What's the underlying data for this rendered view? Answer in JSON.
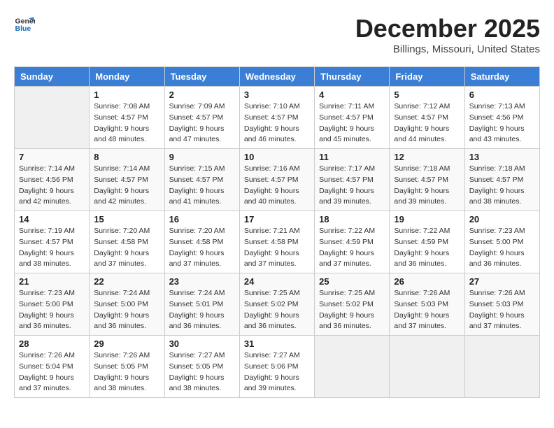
{
  "logo": {
    "line1": "General",
    "line2": "Blue"
  },
  "title": "December 2025",
  "subtitle": "Billings, Missouri, United States",
  "weekdays": [
    "Sunday",
    "Monday",
    "Tuesday",
    "Wednesday",
    "Thursday",
    "Friday",
    "Saturday"
  ],
  "weeks": [
    [
      {
        "day": "",
        "info": ""
      },
      {
        "day": "1",
        "info": "Sunrise: 7:08 AM\nSunset: 4:57 PM\nDaylight: 9 hours\nand 48 minutes."
      },
      {
        "day": "2",
        "info": "Sunrise: 7:09 AM\nSunset: 4:57 PM\nDaylight: 9 hours\nand 47 minutes."
      },
      {
        "day": "3",
        "info": "Sunrise: 7:10 AM\nSunset: 4:57 PM\nDaylight: 9 hours\nand 46 minutes."
      },
      {
        "day": "4",
        "info": "Sunrise: 7:11 AM\nSunset: 4:57 PM\nDaylight: 9 hours\nand 45 minutes."
      },
      {
        "day": "5",
        "info": "Sunrise: 7:12 AM\nSunset: 4:57 PM\nDaylight: 9 hours\nand 44 minutes."
      },
      {
        "day": "6",
        "info": "Sunrise: 7:13 AM\nSunset: 4:56 PM\nDaylight: 9 hours\nand 43 minutes."
      }
    ],
    [
      {
        "day": "7",
        "info": "Sunrise: 7:14 AM\nSunset: 4:56 PM\nDaylight: 9 hours\nand 42 minutes."
      },
      {
        "day": "8",
        "info": "Sunrise: 7:14 AM\nSunset: 4:57 PM\nDaylight: 9 hours\nand 42 minutes."
      },
      {
        "day": "9",
        "info": "Sunrise: 7:15 AM\nSunset: 4:57 PM\nDaylight: 9 hours\nand 41 minutes."
      },
      {
        "day": "10",
        "info": "Sunrise: 7:16 AM\nSunset: 4:57 PM\nDaylight: 9 hours\nand 40 minutes."
      },
      {
        "day": "11",
        "info": "Sunrise: 7:17 AM\nSunset: 4:57 PM\nDaylight: 9 hours\nand 39 minutes."
      },
      {
        "day": "12",
        "info": "Sunrise: 7:18 AM\nSunset: 4:57 PM\nDaylight: 9 hours\nand 39 minutes."
      },
      {
        "day": "13",
        "info": "Sunrise: 7:18 AM\nSunset: 4:57 PM\nDaylight: 9 hours\nand 38 minutes."
      }
    ],
    [
      {
        "day": "14",
        "info": "Sunrise: 7:19 AM\nSunset: 4:57 PM\nDaylight: 9 hours\nand 38 minutes."
      },
      {
        "day": "15",
        "info": "Sunrise: 7:20 AM\nSunset: 4:58 PM\nDaylight: 9 hours\nand 37 minutes."
      },
      {
        "day": "16",
        "info": "Sunrise: 7:20 AM\nSunset: 4:58 PM\nDaylight: 9 hours\nand 37 minutes."
      },
      {
        "day": "17",
        "info": "Sunrise: 7:21 AM\nSunset: 4:58 PM\nDaylight: 9 hours\nand 37 minutes."
      },
      {
        "day": "18",
        "info": "Sunrise: 7:22 AM\nSunset: 4:59 PM\nDaylight: 9 hours\nand 37 minutes."
      },
      {
        "day": "19",
        "info": "Sunrise: 7:22 AM\nSunset: 4:59 PM\nDaylight: 9 hours\nand 36 minutes."
      },
      {
        "day": "20",
        "info": "Sunrise: 7:23 AM\nSunset: 5:00 PM\nDaylight: 9 hours\nand 36 minutes."
      }
    ],
    [
      {
        "day": "21",
        "info": "Sunrise: 7:23 AM\nSunset: 5:00 PM\nDaylight: 9 hours\nand 36 minutes."
      },
      {
        "day": "22",
        "info": "Sunrise: 7:24 AM\nSunset: 5:00 PM\nDaylight: 9 hours\nand 36 minutes."
      },
      {
        "day": "23",
        "info": "Sunrise: 7:24 AM\nSunset: 5:01 PM\nDaylight: 9 hours\nand 36 minutes."
      },
      {
        "day": "24",
        "info": "Sunrise: 7:25 AM\nSunset: 5:02 PM\nDaylight: 9 hours\nand 36 minutes."
      },
      {
        "day": "25",
        "info": "Sunrise: 7:25 AM\nSunset: 5:02 PM\nDaylight: 9 hours\nand 36 minutes."
      },
      {
        "day": "26",
        "info": "Sunrise: 7:26 AM\nSunset: 5:03 PM\nDaylight: 9 hours\nand 37 minutes."
      },
      {
        "day": "27",
        "info": "Sunrise: 7:26 AM\nSunset: 5:03 PM\nDaylight: 9 hours\nand 37 minutes."
      }
    ],
    [
      {
        "day": "28",
        "info": "Sunrise: 7:26 AM\nSunset: 5:04 PM\nDaylight: 9 hours\nand 37 minutes."
      },
      {
        "day": "29",
        "info": "Sunrise: 7:26 AM\nSunset: 5:05 PM\nDaylight: 9 hours\nand 38 minutes."
      },
      {
        "day": "30",
        "info": "Sunrise: 7:27 AM\nSunset: 5:05 PM\nDaylight: 9 hours\nand 38 minutes."
      },
      {
        "day": "31",
        "info": "Sunrise: 7:27 AM\nSunset: 5:06 PM\nDaylight: 9 hours\nand 39 minutes."
      },
      {
        "day": "",
        "info": ""
      },
      {
        "day": "",
        "info": ""
      },
      {
        "day": "",
        "info": ""
      }
    ]
  ]
}
